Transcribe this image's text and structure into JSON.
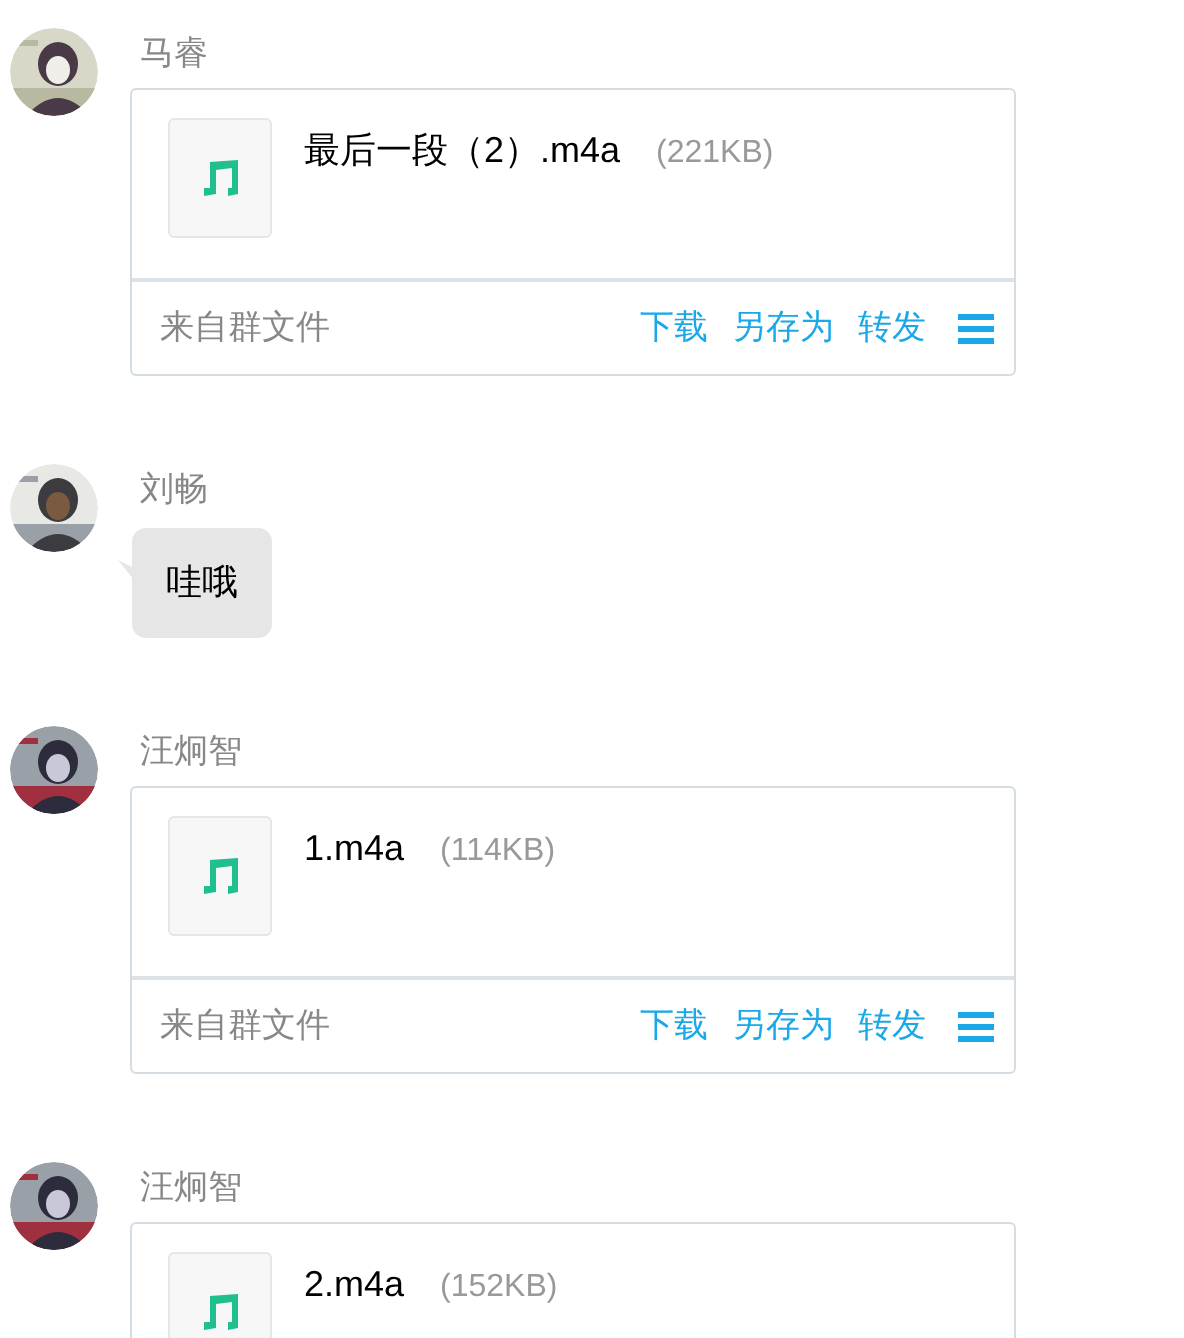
{
  "messages": [
    {
      "kind": "file",
      "sender": "马睿",
      "file_name": "最后一段（2）.m4a",
      "file_size": "(221KB)",
      "footer": {
        "source": "来自群文件",
        "actions": [
          "下载",
          "另存为",
          "转发"
        ]
      }
    },
    {
      "kind": "text",
      "sender": "刘畅",
      "text": "哇哦"
    },
    {
      "kind": "file",
      "sender": "汪炯智",
      "file_name": "1.m4a",
      "file_size": "(114KB)",
      "footer": {
        "source": "来自群文件",
        "actions": [
          "下载",
          "另存为",
          "转发"
        ]
      }
    },
    {
      "kind": "file",
      "sender": "汪炯智",
      "file_name": "2.m4a",
      "file_size": "(152KB)"
    }
  ]
}
